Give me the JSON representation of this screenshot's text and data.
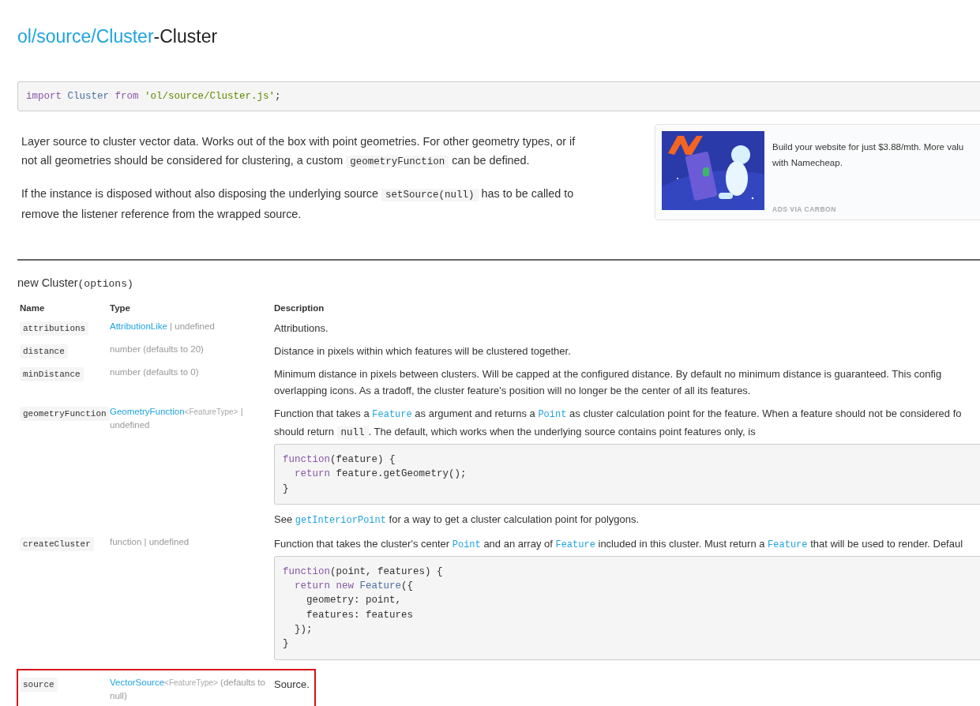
{
  "title": {
    "link": "ol/source/Cluster",
    "suffix": "-Cluster"
  },
  "import_code": [
    {
      "kind": "keyword",
      "text": "import"
    },
    {
      "kind": "type",
      "text": " Cluster "
    },
    {
      "kind": "keyword",
      "text": "from"
    },
    {
      "kind": "string",
      "text": " 'ol/source/Cluster.js'"
    },
    {
      "kind": "plain",
      "text": ";"
    }
  ],
  "intro": [
    [
      [
        {
          "kind": "text",
          "text": "Layer source to cluster vector data. Works out of the box with point geometries. For other geometry types, or if"
        }
      ],
      [
        {
          "kind": "text",
          "text": "not all geometries should be considered for clustering, a custom "
        },
        {
          "kind": "code",
          "text": "geometryFunction"
        },
        {
          "kind": "text",
          "text": " can be defined."
        }
      ]
    ],
    [
      [
        {
          "kind": "text",
          "text": "If the instance is disposed without also disposing the underlying source "
        },
        {
          "kind": "code",
          "text": "setSource(null)"
        },
        {
          "kind": "text",
          "text": " has to be called to"
        }
      ],
      [
        {
          "kind": "text",
          "text": "remove the listener reference from the wrapped source."
        }
      ]
    ]
  ],
  "ad": {
    "kind": "picture",
    "lines": [
      "Build your website for just $3.88/mth. More valu",
      "with Namecheap."
    ],
    "label": "ADS VIA CARBON"
  },
  "constructor": {
    "name": "new Cluster",
    "args": "(options)"
  },
  "columns": [
    "Name",
    "Type",
    "Description"
  ],
  "rows": [
    {
      "name": "attributions",
      "highlighted": false,
      "type": [
        {
          "kind": "link",
          "text": "AttributionLike"
        },
        {
          "kind": "muted",
          "text": " | undefined"
        }
      ],
      "description": [
        {
          "kind": "line",
          "segments": [
            {
              "kind": "text",
              "text": "Attributions."
            }
          ]
        }
      ]
    },
    {
      "name": "distance",
      "highlighted": false,
      "type": [
        {
          "kind": "muted",
          "text": "number (defaults to 20)"
        }
      ],
      "description": [
        {
          "kind": "line",
          "segments": [
            {
              "kind": "text",
              "text": "Distance in pixels within which features will be clustered together."
            }
          ]
        }
      ]
    },
    {
      "name": "minDistance",
      "highlighted": false,
      "type": [
        {
          "kind": "muted",
          "text": "number (defaults to 0)"
        }
      ],
      "description": [
        {
          "kind": "line",
          "segments": [
            {
              "kind": "text",
              "text": "Minimum distance in pixels between clusters. Will be capped at the configured distance. By default no minimum distance is guaranteed. This config"
            }
          ]
        },
        {
          "kind": "line",
          "segments": [
            {
              "kind": "text",
              "text": "overlapping icons. As a tradoff, the cluster feature's position will no longer be the center of all its features."
            }
          ]
        }
      ]
    },
    {
      "name": "geometryFunction",
      "highlighted": false,
      "type": [
        {
          "kind": "link",
          "text": "GeometryFunction"
        },
        {
          "kind": "generic",
          "text": "<FeatureType>"
        },
        {
          "kind": "muted",
          "text": " | undefined"
        }
      ],
      "description": [
        {
          "kind": "line",
          "segments": [
            {
              "kind": "text",
              "text": "Function that takes a "
            },
            {
              "kind": "codelink",
              "text": "Feature"
            },
            {
              "kind": "text",
              "text": " as argument and returns a "
            },
            {
              "kind": "codelink",
              "text": "Point"
            },
            {
              "kind": "text",
              "text": " as cluster calculation point for the feature. When a feature should not be considered fo"
            }
          ]
        },
        {
          "kind": "line",
          "segments": [
            {
              "kind": "text",
              "text": "should return "
            },
            {
              "kind": "code",
              "text": "null"
            },
            {
              "kind": "text",
              "text": ". The default, which works when the underlying source contains point features only, is"
            }
          ]
        },
        {
          "kind": "code",
          "lines": [
            [
              {
                "kind": "keyword",
                "text": "function"
              },
              {
                "kind": "plain",
                "text": "(feature) {"
              }
            ],
            [
              {
                "kind": "keyword",
                "text": "  return"
              },
              {
                "kind": "plain",
                "text": " feature.getGeometry();"
              }
            ],
            [
              {
                "kind": "plain",
                "text": "}"
              }
            ]
          ]
        },
        {
          "kind": "line",
          "segments": [
            {
              "kind": "text",
              "text": "See "
            },
            {
              "kind": "codelink",
              "text": "getInteriorPoint"
            },
            {
              "kind": "text",
              "text": " for a way to get a cluster calculation point for polygons."
            }
          ]
        }
      ]
    },
    {
      "name": "createCluster",
      "highlighted": false,
      "type": [
        {
          "kind": "muted",
          "text": "function | undefined"
        }
      ],
      "description": [
        {
          "kind": "line",
          "segments": [
            {
              "kind": "text",
              "text": "Function that takes the cluster's center "
            },
            {
              "kind": "codelink",
              "text": "Point"
            },
            {
              "kind": "text",
              "text": " and an array of "
            },
            {
              "kind": "codelink",
              "text": "Feature"
            },
            {
              "kind": "text",
              "text": " included in this cluster. Must return a "
            },
            {
              "kind": "codelink",
              "text": "Feature"
            },
            {
              "kind": "text",
              "text": " that will be used to render. Defaul"
            }
          ]
        },
        {
          "kind": "code",
          "lines": [
            [
              {
                "kind": "keyword",
                "text": "function"
              },
              {
                "kind": "plain",
                "text": "(point, features) {"
              }
            ],
            [
              {
                "kind": "keyword",
                "text": "  return new"
              },
              {
                "kind": "type",
                "text": " Feature"
              },
              {
                "kind": "plain",
                "text": "({"
              }
            ],
            [
              {
                "kind": "plain",
                "text": "    geometry: point,"
              }
            ],
            [
              {
                "kind": "plain",
                "text": "    features: features"
              }
            ],
            [
              {
                "kind": "plain",
                "text": "  });"
              }
            ],
            [
              {
                "kind": "plain",
                "text": "}"
              }
            ]
          ]
        }
      ]
    },
    {
      "name": "source",
      "highlighted": true,
      "type": [
        {
          "kind": "link",
          "text": "VectorSource"
        },
        {
          "kind": "generic",
          "text": "<FeatureType>"
        },
        {
          "kind": "muted",
          "text": " (defaults to null)"
        }
      ],
      "description": [
        {
          "kind": "line",
          "segments": [
            {
              "kind": "text",
              "text": "Source."
            }
          ]
        }
      ]
    }
  ]
}
